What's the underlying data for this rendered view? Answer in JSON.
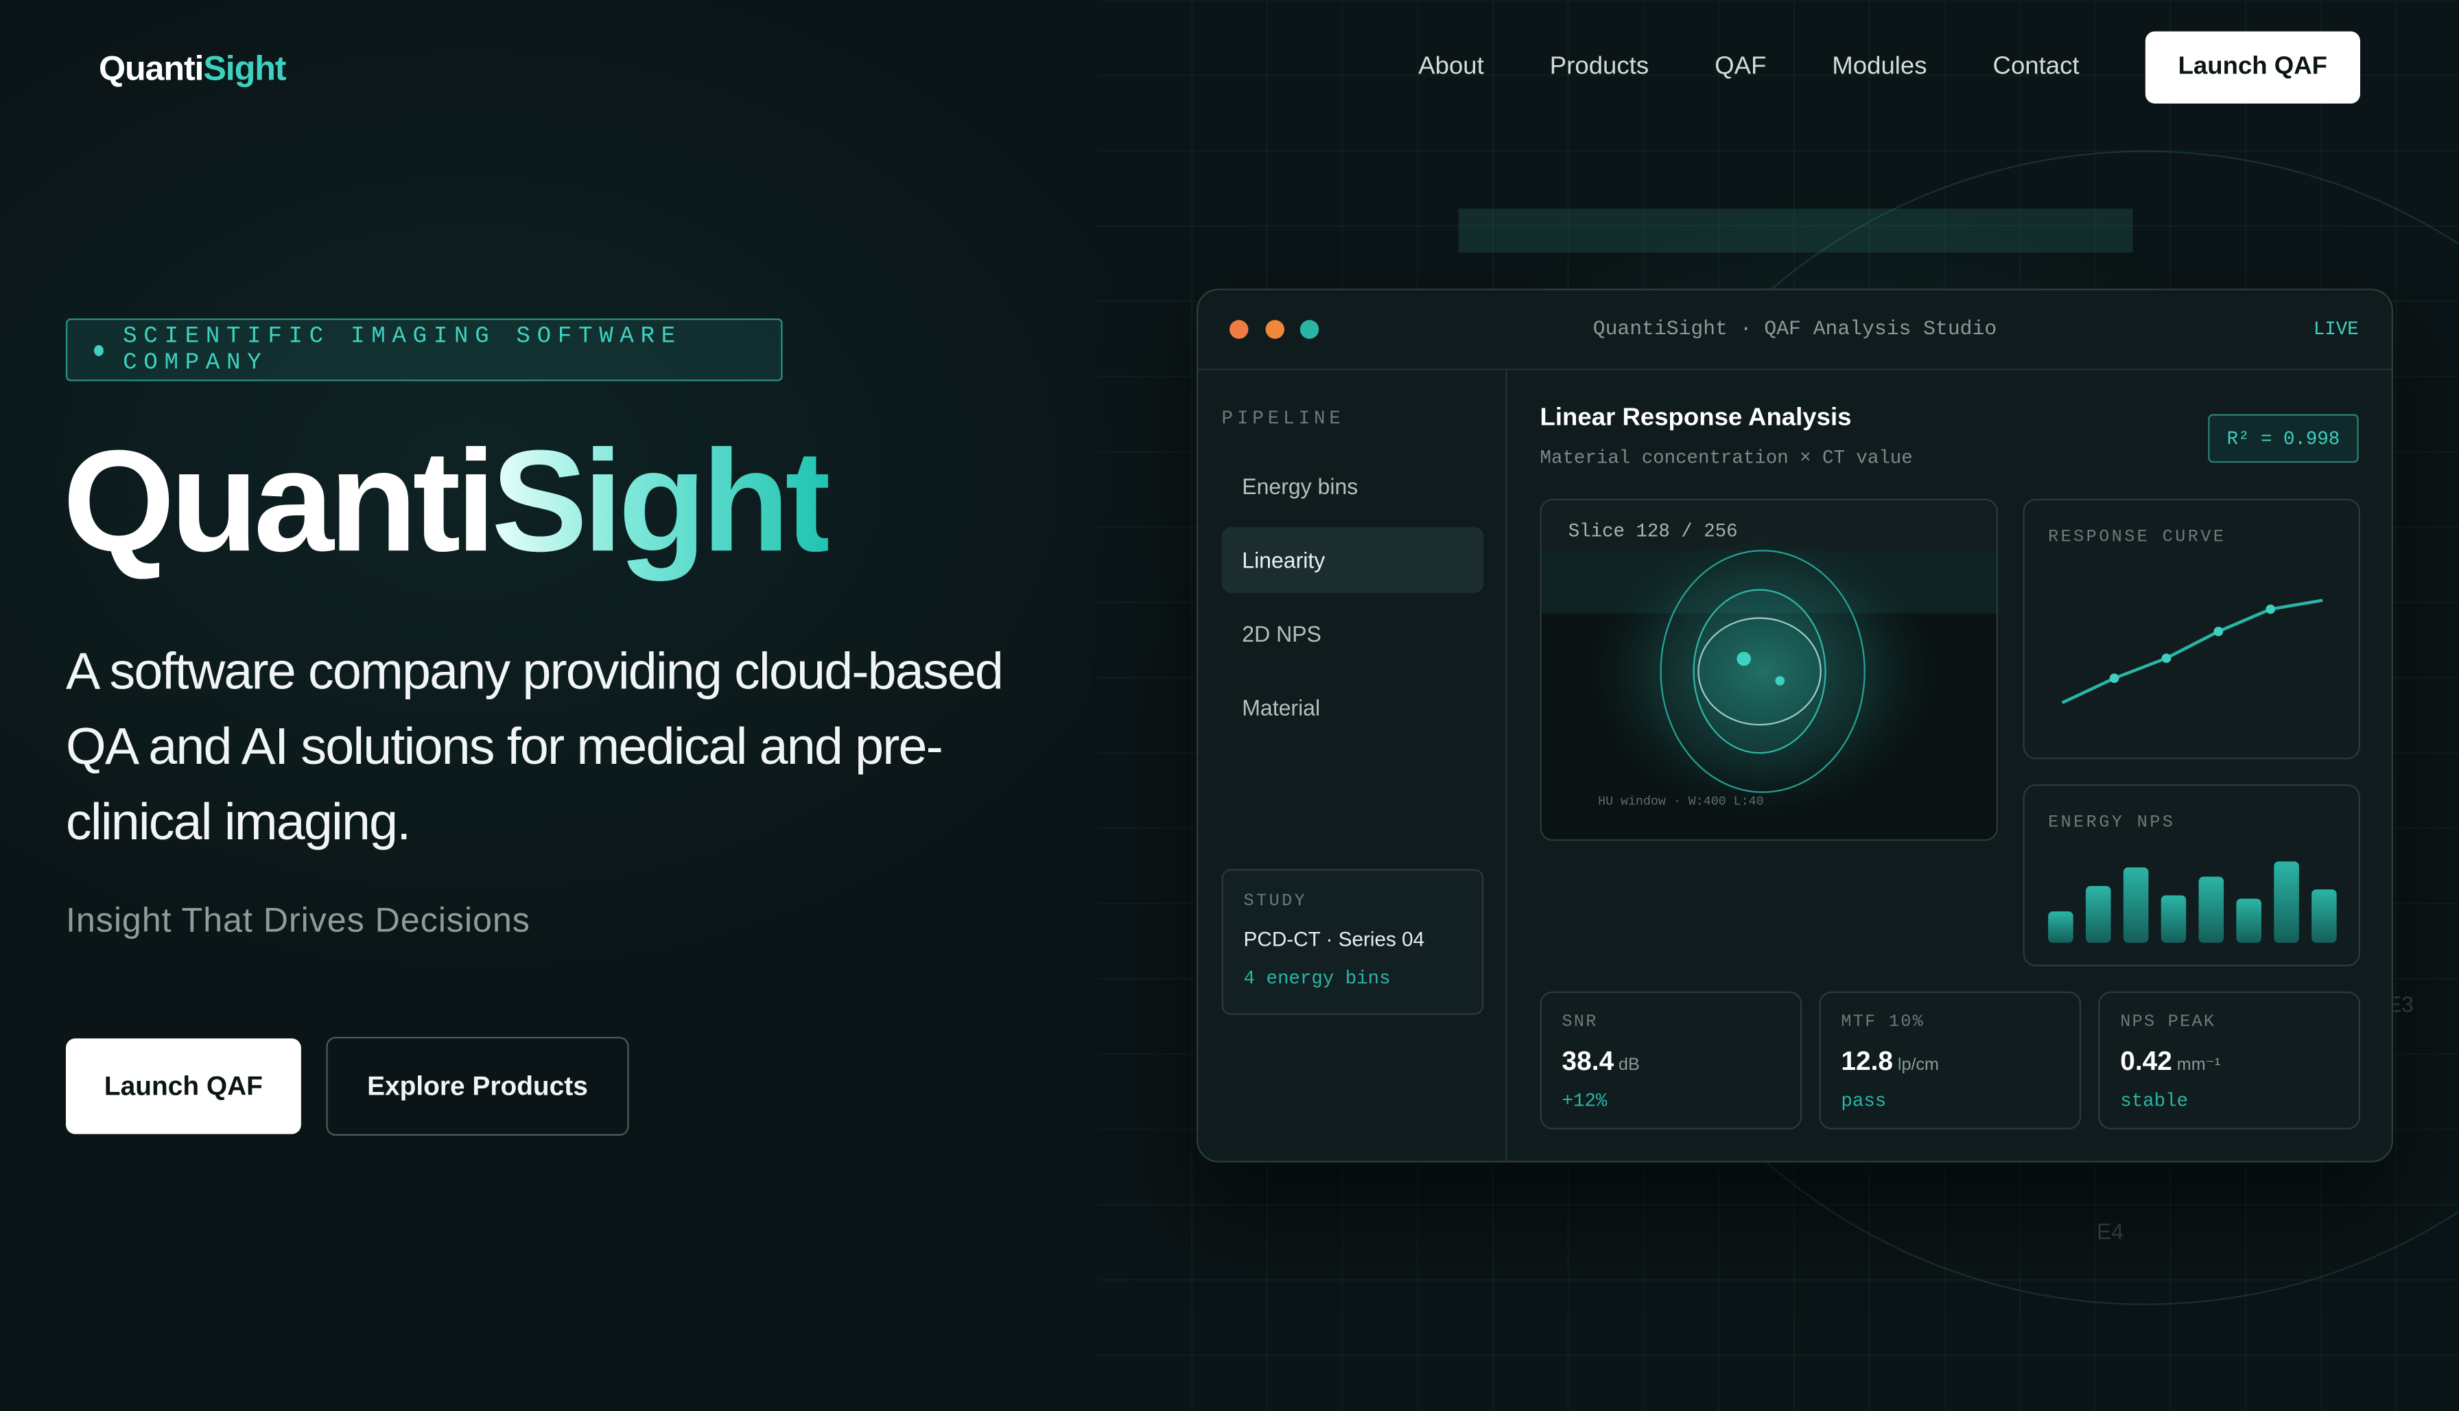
{
  "brand": {
    "part1": "Quanti",
    "part2": "Sight"
  },
  "nav": {
    "items": [
      "About",
      "Products",
      "QAF",
      "Modules",
      "Contact"
    ],
    "cta": "Launch QAF"
  },
  "hero": {
    "badge": "SCIENTIFIC IMAGING SOFTWARE COMPANY",
    "title_part1": "Quanti",
    "title_part2": "Sight",
    "tagline": "A software company providing cloud-based QA and AI solutions for medical and pre-clinical imaging.",
    "subtitle": "Insight That Drives Decisions",
    "primary_button": "Launch QAF",
    "secondary_button": "Explore Products"
  },
  "background_labels": [
    "E3",
    "E4"
  ],
  "app": {
    "window_title": "QuantiSight · QAF Analysis Studio",
    "status": "LIVE",
    "traffic_lights": [
      "#f07c45",
      "#f0873a",
      "#2bb5a6"
    ],
    "sidebar": {
      "heading": "PIPELINE",
      "items": [
        "Energy bins",
        "Linearity",
        "2D NPS",
        "Material"
      ],
      "active_index": 1,
      "study": {
        "label": "STUDY",
        "value": "PCD-CT · Series 04",
        "meta": "4 energy bins"
      }
    },
    "main": {
      "title": "Linear Response Analysis",
      "subtitle": "Material concentration × CT value",
      "fit_badge": "R² = 0.998",
      "slice_label": "Slice 128 / 256",
      "window_label": "HU window · W:400 L:40",
      "response_label": "RESPONSE CURVE",
      "nps_label": "ENERGY NPS"
    },
    "metrics": [
      {
        "label": "SNR",
        "value": "38.4",
        "unit": "dB",
        "note": "+12%"
      },
      {
        "label": "MTF 10%",
        "value": "12.8",
        "unit": "lp/cm",
        "note": "pass"
      },
      {
        "label": "NPS PEAK",
        "value": "0.42",
        "unit": "mm⁻¹",
        "note": "stable"
      }
    ]
  },
  "accent_color": "#3ed1c0",
  "chart_data": [
    {
      "type": "line",
      "title": "RESPONSE CURVE",
      "x": [
        0,
        1,
        2,
        3,
        4,
        5
      ],
      "values": [
        0.0,
        0.22,
        0.4,
        0.64,
        0.84,
        0.92
      ],
      "markers_at": [
        1,
        2,
        3,
        4
      ]
    },
    {
      "type": "bar",
      "title": "ENERGY NPS",
      "values": [
        0.37,
        0.67,
        0.89,
        0.56,
        0.78,
        0.52,
        0.96,
        0.63
      ]
    }
  ]
}
